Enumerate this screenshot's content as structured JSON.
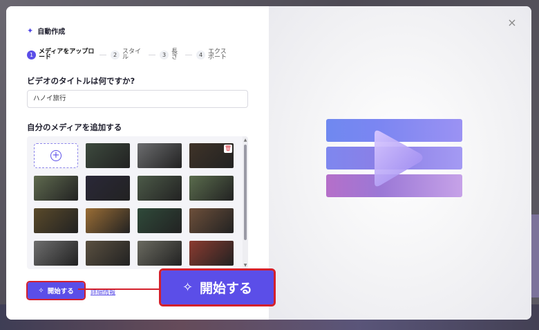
{
  "dialog": {
    "header_title": "自動作成",
    "close_symbol": "×"
  },
  "steps": [
    {
      "num": "1",
      "label": "メディアをアップロード",
      "active": true
    },
    {
      "num": "2",
      "label": "スタイル",
      "active": false
    },
    {
      "num": "3",
      "label": "長さ",
      "active": false
    },
    {
      "num": "4",
      "label": "エクスポート",
      "active": false
    }
  ],
  "title_question": "ビデオのタイトルは何ですか?",
  "title_input": {
    "value": "ハノイ旅行"
  },
  "media_section": {
    "label": "自分のメディアを追加する",
    "add_symbol": "+",
    "thumbnails": [
      {
        "color": "#3d4a3e"
      },
      {
        "color": "#6b6c6e"
      },
      {
        "color": "#3f3328"
      },
      {
        "color": "#5f6a4f"
      },
      {
        "color": "#2a2838"
      },
      {
        "color": "#4c5a48"
      },
      {
        "color": "#5a6c4d"
      },
      {
        "color": "#5a4a2a"
      },
      {
        "color": "#9a6d35"
      },
      {
        "color": "#2f4a3a"
      },
      {
        "color": "#6d4f3a"
      },
      {
        "color": "#6e6e6e"
      },
      {
        "color": "#5a5040"
      },
      {
        "color": "#6a6a60"
      },
      {
        "color": "#8b3b30"
      }
    ]
  },
  "actions": {
    "start_label": "開始する",
    "detail_label": "詳細情報",
    "start_big_label": "開始する"
  },
  "colors": {
    "accent": "#5b4ee8",
    "highlight": "#d4202c"
  }
}
